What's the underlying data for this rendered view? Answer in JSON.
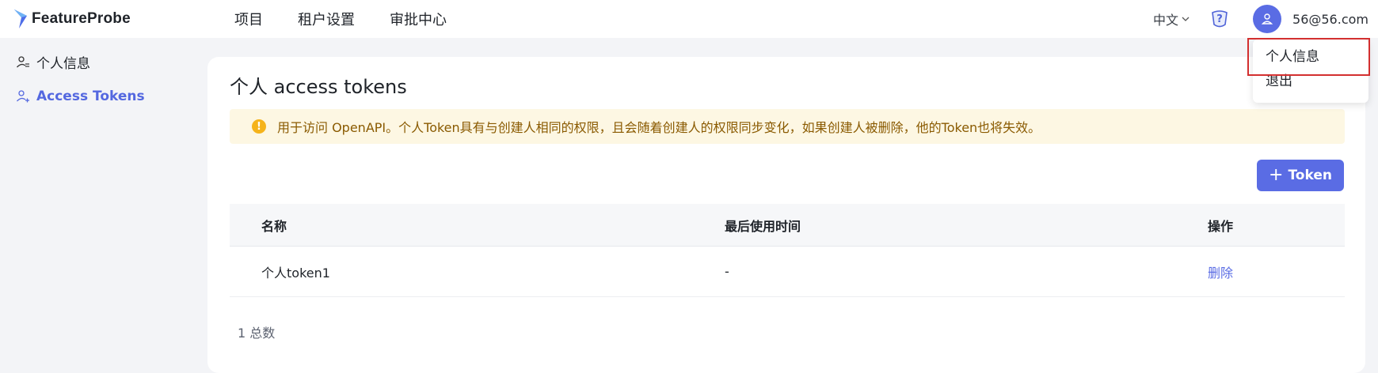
{
  "header": {
    "logo_text": "FeatureProbe",
    "nav": [
      "项目",
      "租户设置",
      "审批中心"
    ],
    "language": "中文",
    "user_email": "56@56.com"
  },
  "sidebar": {
    "items": [
      {
        "label": "个人信息",
        "icon": "user-info-icon",
        "active": false
      },
      {
        "label": "Access Tokens",
        "icon": "user-add-icon",
        "active": true
      }
    ]
  },
  "main": {
    "title": "个人 access tokens",
    "notice": "用于访问 OpenAPI。个人Token具有与创建人相同的权限，且会随着创建人的权限同步变化，如果创建人被删除，他的Token也将失效。",
    "add_button": "Token",
    "table": {
      "headers": [
        "名称",
        "最后使用时间",
        "操作"
      ],
      "rows": [
        {
          "name": "个人token1",
          "last_used": "-",
          "action": "删除"
        }
      ]
    },
    "total": "1 总数"
  },
  "dropdown": {
    "items": [
      "个人信息",
      "退出"
    ]
  },
  "colors": {
    "accent": "#5a6ce4",
    "notice_bg": "#fdf7e3",
    "warning": "#f5b31b",
    "highlight_border": "#d32f2f"
  }
}
